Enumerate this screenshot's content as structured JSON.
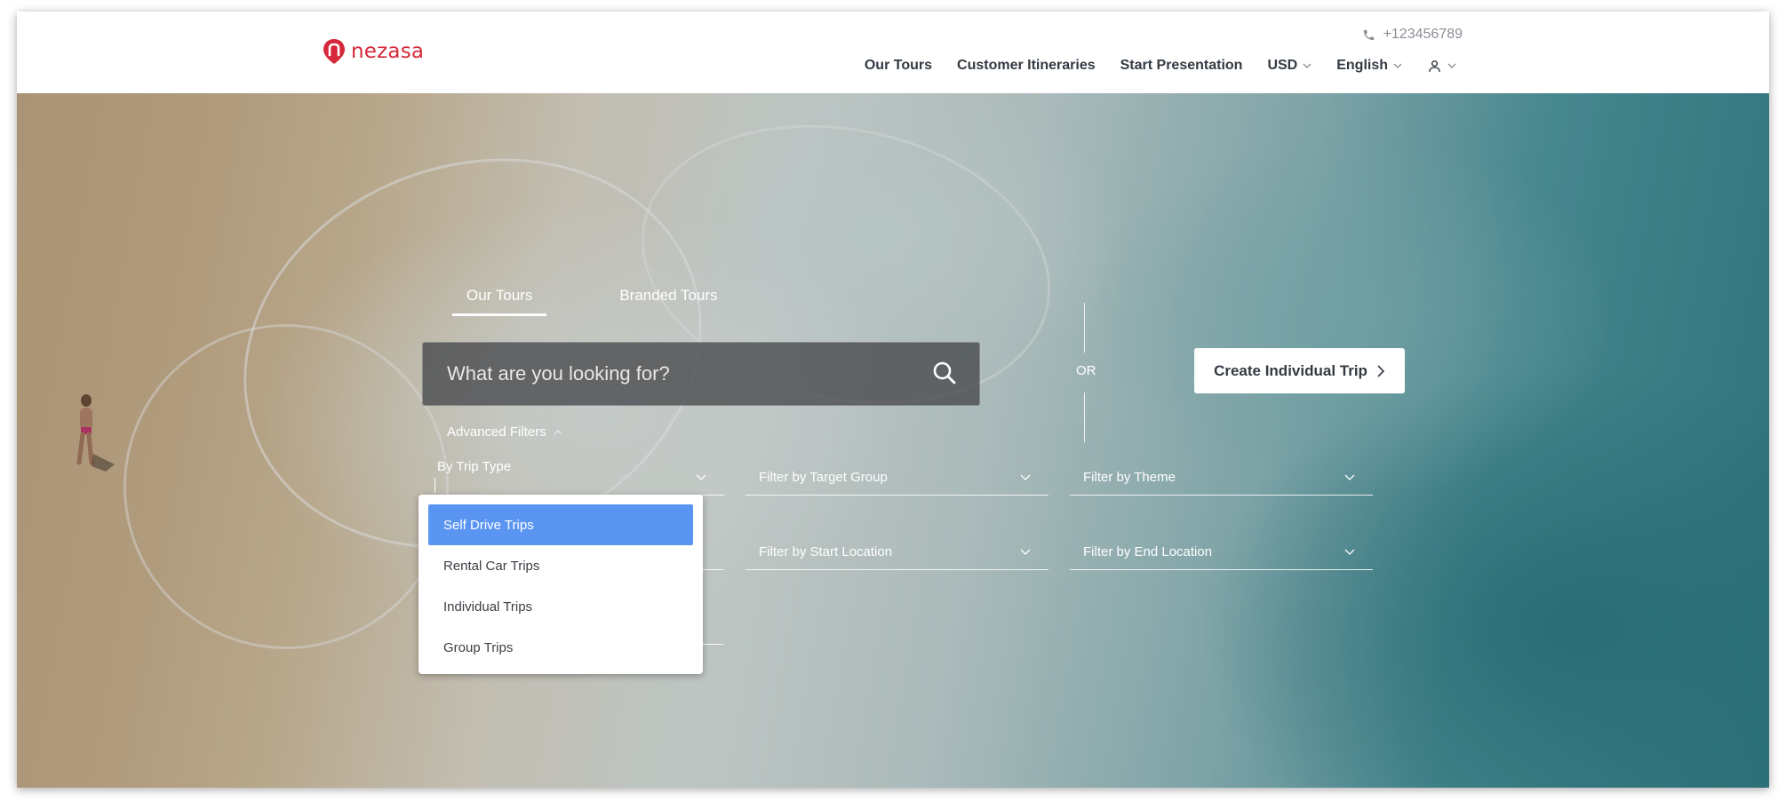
{
  "brand": {
    "name": "nezasa",
    "color": "#d6283a"
  },
  "header": {
    "phone": "+123456789",
    "nav": [
      {
        "label": "Our Tours"
      },
      {
        "label": "Customer Itineraries"
      },
      {
        "label": "Start Presentation"
      },
      {
        "label": "USD"
      },
      {
        "label": "English"
      }
    ]
  },
  "hero": {
    "tabs": [
      {
        "label": "Our Tours",
        "active": true
      },
      {
        "label": "Branded Tours",
        "active": false
      }
    ],
    "search": {
      "placeholder": "What are you looking for?"
    },
    "or_label": "OR",
    "create_button": "Create Individual Trip",
    "advanced_filters": "Advanced Filters",
    "filters": {
      "trip_type": "By Trip Type",
      "target_group": "Filter by Target Group",
      "theme": "Filter by Theme",
      "start_location": "Filter by Start Location",
      "end_location": "Filter by End Location"
    },
    "trip_type_options": [
      {
        "label": "Self Drive Trips",
        "selected": true
      },
      {
        "label": "Rental Car Trips",
        "selected": false
      },
      {
        "label": "Individual Trips",
        "selected": false
      },
      {
        "label": "Group Trips",
        "selected": false
      }
    ],
    "selected_color": "#5b95f2"
  }
}
